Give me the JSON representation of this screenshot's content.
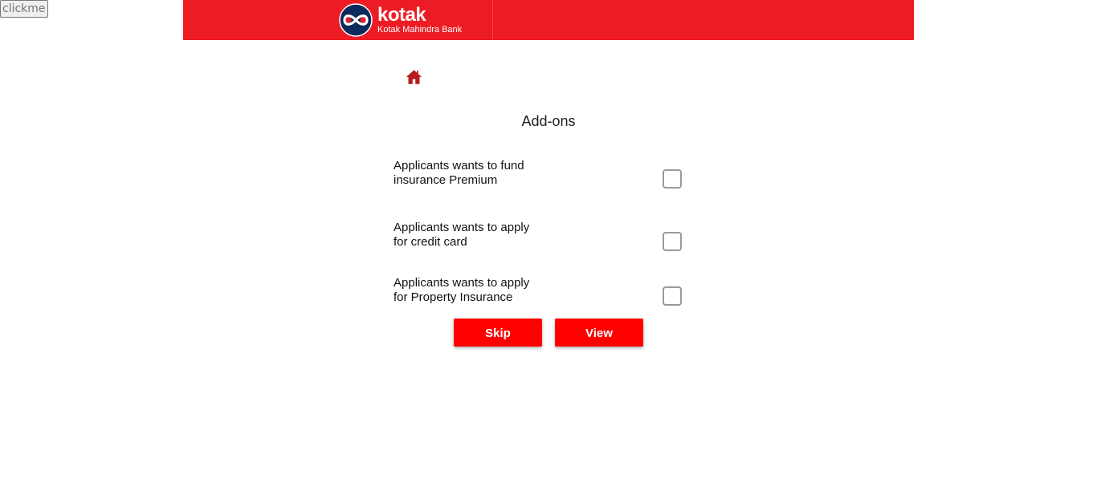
{
  "debug": {
    "button_label": "clickme"
  },
  "header": {
    "brand": "kotak",
    "brand_sub": "Kotak Mahindra Bank",
    "background": "#ed1c24"
  },
  "home": {
    "icon": "home-icon",
    "color": "#b71c1c"
  },
  "page": {
    "title": "Add-ons"
  },
  "options": [
    {
      "line1": "Applicants wants to fund",
      "line2": "insurance Premium",
      "checked": false
    },
    {
      "line1": "Applicants wants to apply",
      "line2": "for credit card",
      "checked": false
    },
    {
      "line1": "Applicants wants to apply",
      "line2": "for Property Insurance",
      "checked": false
    }
  ],
  "actions": {
    "skip_label": "Skip",
    "view_label": "View",
    "button_color": "#ff0000"
  }
}
